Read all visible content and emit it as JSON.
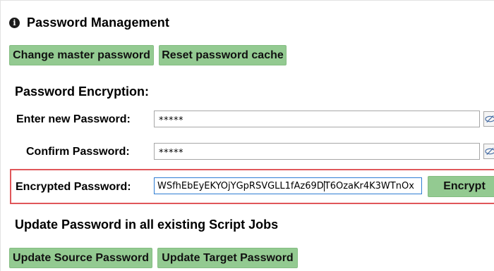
{
  "header": {
    "title": "Password Management",
    "icon": "info-icon"
  },
  "toolbar": {
    "change_master_label": "Change master password",
    "reset_cache_label": "Reset password cache"
  },
  "encryption": {
    "section_title": "Password Encryption:",
    "new_password_label": "Enter new Password:",
    "new_password_value": "*****",
    "confirm_password_label": "Confirm Password:",
    "confirm_password_value": "*****",
    "encrypted_label": "Encrypted Password:",
    "encrypted_value_before_caret": "WSfhEbEyEKYOjYGpRSVGLL1fAz69D",
    "encrypted_value_after_caret": "T6OzaKr4K3WTnOx",
    "encrypt_button": "Encrypt"
  },
  "update": {
    "section_title": "Update Password in all existing Script Jobs",
    "source_button": "Update Source Password",
    "target_button": "Update Target Password"
  },
  "colors": {
    "button_green": "#93ca91",
    "highlight_red": "#e0575a",
    "focus_blue": "#2f7dd3"
  }
}
